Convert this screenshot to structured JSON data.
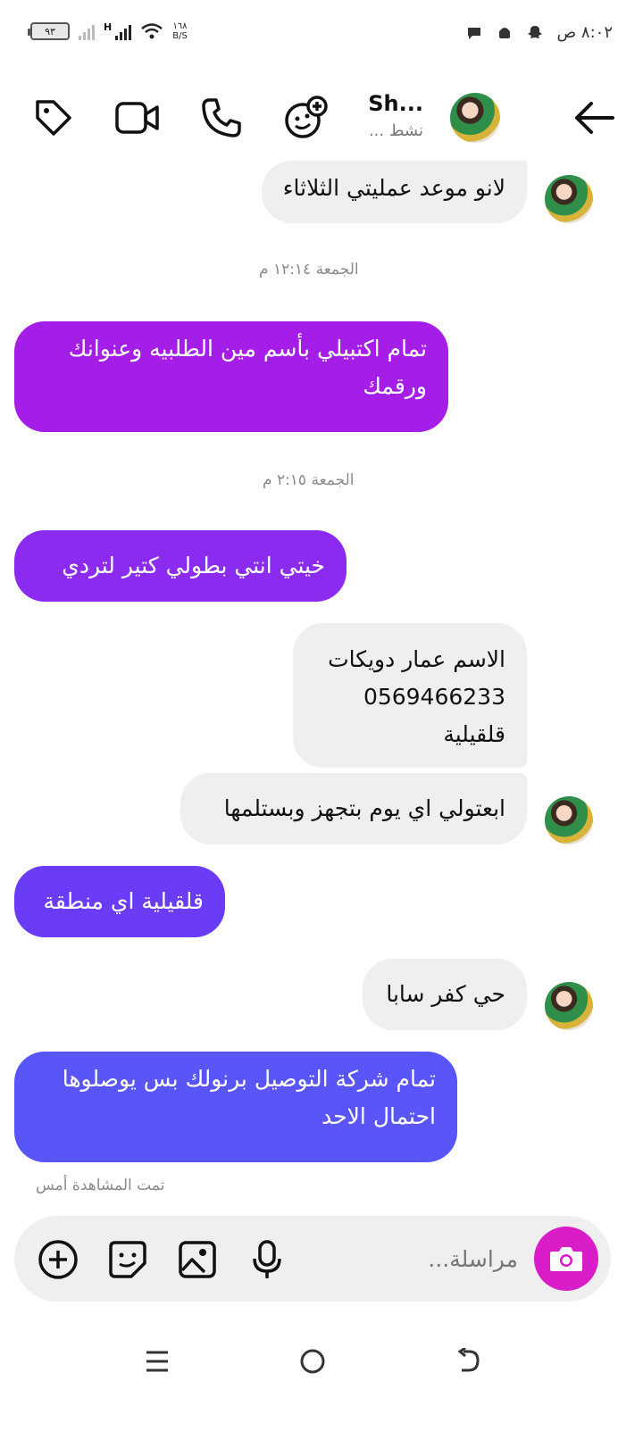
{
  "status_bar": {
    "battery": "٩٣",
    "network_type": "H",
    "speed_value": "١٦٨",
    "speed_unit": "B/S",
    "time": "٨:٠٢ ص"
  },
  "header": {
    "name": "Sh...",
    "status": "نشط ..."
  },
  "messages": [
    {
      "side": "in",
      "text": "لانو موعد عمليتي الثلاثاء"
    },
    {
      "type": "timestamp",
      "text": "الجمعة ١٢:١٤ م"
    },
    {
      "side": "out",
      "text": "تمام اكتبيلي بأسم مين الطلبيه وعنوانك\nورقمك",
      "color": "#a41ee8"
    },
    {
      "type": "timestamp",
      "text": "الجمعة ٢:١٥ م"
    },
    {
      "side": "out",
      "text": "خيتي انتي بطولي كتير لتردي",
      "color": "#8a2bef"
    },
    {
      "side": "in",
      "text": "الاسم عمار دويكات\n0569466233\nقلقيلية"
    },
    {
      "side": "in",
      "text": "ابعتولي اي يوم بتجهز وبستلمها"
    },
    {
      "side": "out",
      "text": "قلقيلية اي منطقة",
      "color": "#6a3cf7"
    },
    {
      "side": "in",
      "text": "حي كفر سابا"
    },
    {
      "side": "out",
      "text": "تمام شركة التوصيل برنولك بس يوصلوها\nاحتمال الاحد",
      "color": "#5a55f8"
    }
  ],
  "seen_label": "تمت المشاهدة أمس",
  "composer": {
    "placeholder": "مراسلة..."
  },
  "colors": {
    "camera_button": "#d91dc8",
    "incoming_bubble": "#efefef"
  },
  "icons": {
    "back": "arrow-left-icon",
    "call": "phone-icon",
    "video": "video-camera-icon",
    "tag": "tag-icon",
    "effects": "emoji-plus-icon",
    "camera": "camera-icon",
    "mic": "microphone-icon",
    "gallery": "image-icon",
    "sticker": "sticker-icon",
    "add": "plus-circle-icon",
    "nav_menu": "menu-icon",
    "nav_home": "home-circle-icon",
    "nav_back": "back-arrow-icon"
  }
}
